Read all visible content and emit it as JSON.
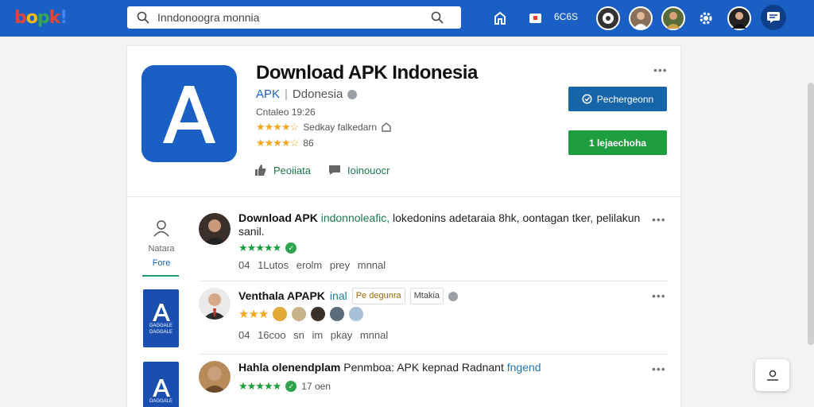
{
  "topbar": {
    "logo": "bopk!",
    "search_value": "Inndonoogra monnia",
    "badge_text": "6C6S",
    "accent": "#1a5fc4"
  },
  "app": {
    "title": "Download APK Indonesia",
    "developer": "APK",
    "developer_name": "Ddonesia",
    "meta": "Cntaleo 19:26",
    "rating_text": "Sedkay falkedarn",
    "rating_count": "86",
    "action_like": "Peoiiata",
    "action_comment": "Ioinouocr",
    "btn_primary": "Pechergeonn",
    "btn_install": "1 lejaechoha"
  },
  "rail": {
    "user_label": "Natara",
    "user_link": "Fore",
    "tile_text": "DAGGALE"
  },
  "items": [
    {
      "title_bold": "Download APK",
      "title_link": "indonnoleafic,",
      "title_rest": "lokedonins adetaraia 8hk, oontagan tker, pelilakun sanil.",
      "meta": "04 1Lutos erolm prey mnnal"
    },
    {
      "title_bold": "Venthala APAPK",
      "title_link": "inal",
      "tag1": "Pe degunra",
      "tag2": "Mtakia",
      "meta": "04 16coo sn im pkay mnnal"
    },
    {
      "title_bold": "Hahla olenendplam",
      "title_rest": "Penmboa: APK kepnad Radnant",
      "title_link": "fngend",
      "count": "17 oen"
    }
  ],
  "icons": {
    "search": "search-icon",
    "home": "home-icon",
    "gear": "gear-icon",
    "chat": "chat-icon"
  }
}
